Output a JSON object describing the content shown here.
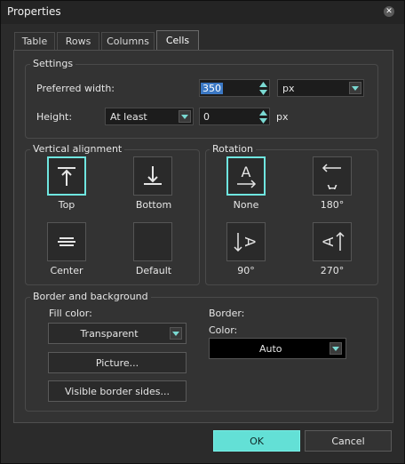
{
  "window": {
    "title": "Properties",
    "close_icon": "close-icon"
  },
  "tabs": [
    {
      "label": "Table",
      "active": false
    },
    {
      "label": "Rows",
      "active": false
    },
    {
      "label": "Columns",
      "active": false
    },
    {
      "label": "Cells",
      "active": true
    }
  ],
  "settings": {
    "group_label": "Settings",
    "preferred_width_label": "Preferred width:",
    "preferred_width_value": "350",
    "preferred_width_unit": "px",
    "height_label": "Height:",
    "height_mode": "At least",
    "height_value": "0",
    "height_unit": "px"
  },
  "vertical_alignment": {
    "group_label": "Vertical alignment",
    "options": [
      {
        "label": "Top",
        "selected": true
      },
      {
        "label": "Bottom",
        "selected": false
      },
      {
        "label": "Center",
        "selected": false
      },
      {
        "label": "Default",
        "selected": false
      }
    ]
  },
  "rotation": {
    "group_label": "Rotation",
    "options": [
      {
        "label": "None",
        "selected": true
      },
      {
        "label": "180°",
        "selected": false
      },
      {
        "label": "90°",
        "selected": false
      },
      {
        "label": "270°",
        "selected": false
      }
    ]
  },
  "border_background": {
    "group_label": "Border and background",
    "fill_color_label": "Fill color:",
    "fill_color_value": "Transparent",
    "picture_button": "Picture...",
    "visible_border_button": "Visible border sides...",
    "border_label": "Border:",
    "color_label": "Color:",
    "border_color_value": "Auto",
    "border_color_swatch": "#000000"
  },
  "footer": {
    "ok": "OK",
    "cancel": "Cancel"
  },
  "colors": {
    "accent": "#63e0d6",
    "background": "#2b2b2b",
    "panel": "#333333"
  }
}
